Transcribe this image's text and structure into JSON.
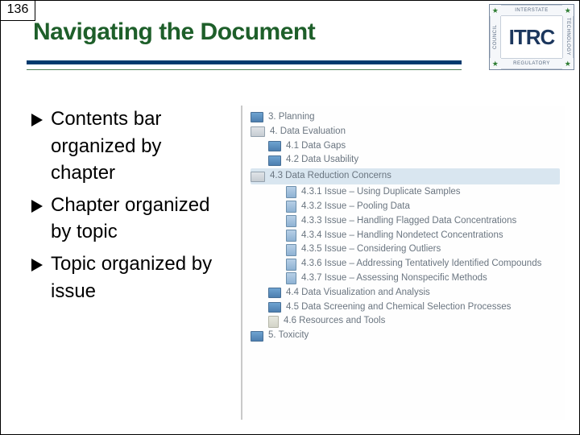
{
  "page_number": "136",
  "title": "Navigating the Document",
  "logo": {
    "top": "INTERSTATE",
    "bottom": "REGULATORY",
    "left": "COUNCIL",
    "right": "TECHNOLOGY",
    "center": "ITRC"
  },
  "bullets": [
    "Contents bar organized by chapter",
    "Chapter organized by topic",
    "Topic organized by issue"
  ],
  "toc": [
    {
      "indent": 1,
      "icon": "book",
      "label": "3. Planning"
    },
    {
      "indent": 1,
      "icon": "book-open",
      "label": "4. Data Evaluation"
    },
    {
      "indent": 2,
      "icon": "book",
      "label": "4.1 Data Gaps"
    },
    {
      "indent": 2,
      "icon": "book",
      "label": "4.2 Data Usability"
    },
    {
      "indent": 2,
      "icon": "book-open",
      "label": "4.3 Data Reduction Concerns",
      "highlight": true
    },
    {
      "indent": 3,
      "icon": "page",
      "label": "4.3.1 Issue – Using Duplicate Samples"
    },
    {
      "indent": 3,
      "icon": "page",
      "label": "4.3.2 Issue – Pooling Data"
    },
    {
      "indent": 3,
      "icon": "page",
      "label": "4.3.3 Issue – Handling Flagged Data Concentrations"
    },
    {
      "indent": 3,
      "icon": "page",
      "label": "4.3.4 Issue – Handling Nondetect Concentrations"
    },
    {
      "indent": 3,
      "icon": "page",
      "label": "4.3.5 Issue – Considering Outliers"
    },
    {
      "indent": 3,
      "icon": "page",
      "label": "4.3.6 Issue – Addressing Tentatively Identified Compounds"
    },
    {
      "indent": 3,
      "icon": "page",
      "label": "4.3.7 Issue – Assessing Nonspecific Methods"
    },
    {
      "indent": 2,
      "icon": "book",
      "label": "4.4 Data Visualization and Analysis"
    },
    {
      "indent": 2,
      "icon": "book",
      "label": "4.5 Data Screening and Chemical Selection Processes"
    },
    {
      "indent": 2,
      "icon": "page-pale",
      "label": "4.6 Resources and Tools"
    },
    {
      "indent": 1,
      "icon": "book",
      "label": "5. Toxicity"
    }
  ]
}
